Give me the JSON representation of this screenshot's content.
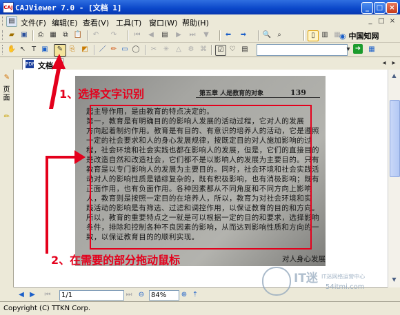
{
  "window": {
    "title": "CAJViewer 7.0 - [文档 1]",
    "app_icon": "CAJ"
  },
  "title_buttons": {
    "minimize": "_",
    "maximize": "□",
    "close": "×"
  },
  "menu": {
    "items": [
      {
        "label": "文件(F)"
      },
      {
        "label": "编辑(E)"
      },
      {
        "label": "查看(V)"
      },
      {
        "label": "工具(T)"
      },
      {
        "label": "窗口(W)"
      },
      {
        "label": "帮助(H)"
      }
    ],
    "cnki_brand": "中国知网",
    "doc_restore_buttons": [
      "_",
      "□",
      "×"
    ]
  },
  "toolbar": {
    "go_arrow": "➜"
  },
  "tab": {
    "label": "文档 1",
    "icon": "PDF"
  },
  "sidebar": {
    "label": "页面"
  },
  "document": {
    "header": "第五章 人是教育的对象",
    "page_number": "139",
    "lines": [
      "起主导作用，是由教育的特点决定的。",
      "    第一，教育是有明确目的的影响人发展的活动过程，它对人的发展",
      "方向起着制约作用。教育是有目的、有意识的培养人的活动，它是遵照",
      "一定的社会要求和人的身心发展规律，按既定目的对人施加影响的过",
      "程，社会环境和社会实践也都在影响人的发展，但是，它们的直接目的",
      "是改造自然和改造社会，它们都不是以影响人的发展为主要目的。只有",
      "教育是以专门影响人的发展为主要目的。同时，社会环境和社会实践活",
      "动对人的影响性质是错综复杂的，既有积极影响，也有消极影响；既有",
      "正面作用，也有负面作用。各种因素都从不同角度和不同方向上影响",
      "人，教育则是按照一定目的在培养人，所以，教育为对社会环境和实",
      "践活动的影响是有筛选、过滤和调控作用，以保证教育的目的和方向。",
      "所以，教育的重要特点之一就是可以根据一定的目的和要求，选择影响",
      "条件，排除和控制各种不良因素的影响，从而达到影响性质和方向的一",
      "致，以保证教育目的的顺利实现。"
    ],
    "bottom_right_text": "对人身心发展起到更大决定作用"
  },
  "annotations": {
    "step1": "1、选择文字识别",
    "step2": "2、在需要的部分拖动鼠标"
  },
  "navigation": {
    "page_value": "1/1",
    "zoom_value": "84%"
  },
  "status": {
    "text": "Copyright (C) TTKN Corp."
  },
  "watermark": {
    "main": "IT迷",
    "sub": "IT迷网络运营中心",
    "url": "54itmi.com"
  },
  "colors": {
    "title_bar": "#0a46c9",
    "annotation_red": "#e4001c",
    "selection_red": "#e4001c"
  }
}
